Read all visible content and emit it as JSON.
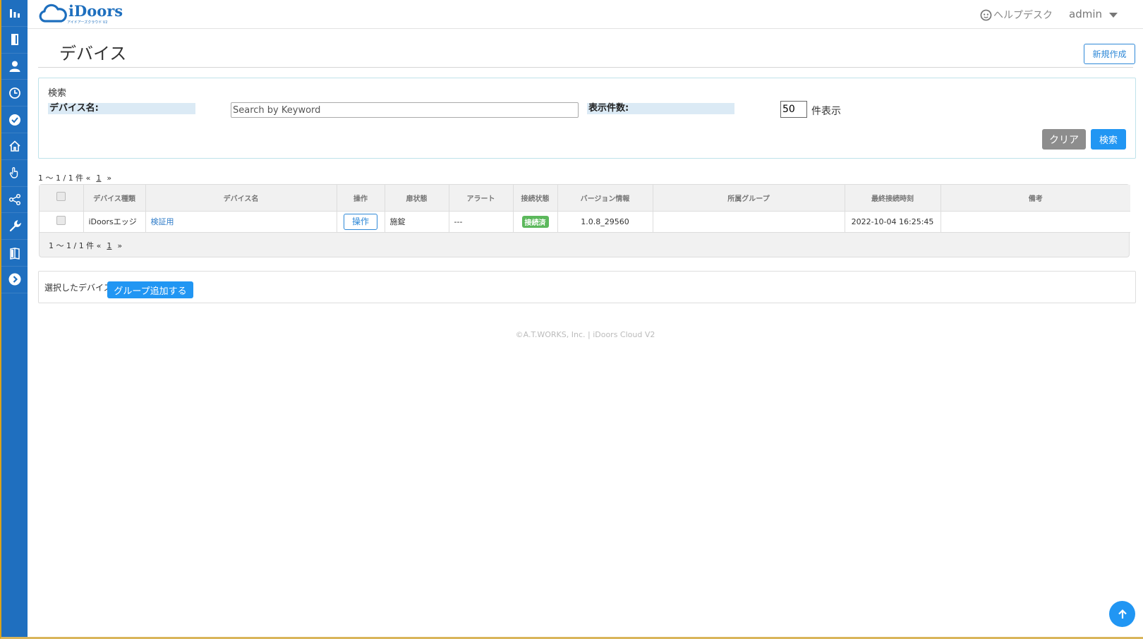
{
  "app": {
    "logo_text": "iDoors",
    "logo_sub": "アイドアーズクラウド V2"
  },
  "header": {
    "helpdesk_label": "ヘルプデスク",
    "user_name": "admin"
  },
  "sidebar": {
    "items": [
      {
        "icon": "bar-chart-icon"
      },
      {
        "icon": "door-icon"
      },
      {
        "icon": "user-icon"
      },
      {
        "icon": "clock-icon"
      },
      {
        "icon": "check-circle-icon"
      },
      {
        "icon": "home-icon"
      },
      {
        "icon": "hand-pointer-icon"
      },
      {
        "icon": "share-icon"
      },
      {
        "icon": "wrench-icon"
      },
      {
        "icon": "book-icon"
      },
      {
        "icon": "chevron-right-circle-icon"
      }
    ]
  },
  "page": {
    "title": "デバイス",
    "new_button": "新規作成"
  },
  "search": {
    "heading": "検索",
    "device_name_label": "デバイス名:",
    "keyword_placeholder": "Search by Keyword",
    "count_label": "表示件数:",
    "count_value": "50",
    "count_suffix": "件表示",
    "clear_button": "クリア",
    "search_button": "検索"
  },
  "pagination": {
    "summary": "1 ～ 1 / 1 件 «",
    "page": "1",
    "next": "»"
  },
  "table": {
    "headers": [
      "デバイス種類",
      "デバイス名",
      "操作",
      "扉状態",
      "アラート",
      "接続状態",
      "バージョン情報",
      "所属グループ",
      "最終接続時刻",
      "備考"
    ],
    "rows": [
      {
        "type": "iDoorsエッジ",
        "name": "検証用",
        "operation": "操作",
        "door_state": "施錠",
        "alert": "---",
        "connection": "接続済",
        "version": "1.0.8_29560",
        "group": "",
        "last_connected": "2022-10-04 16:25:45",
        "note": ""
      }
    ]
  },
  "group_action": {
    "text": "選択したデバイスへ",
    "button": "グループ追加する"
  },
  "footer": {
    "text": "©A.T.WORKS, Inc. | iDoors Cloud V2"
  },
  "colors": {
    "sidebar": "#1f6fbf",
    "accent": "#2196f3",
    "badge_connected": "#5cb85c"
  }
}
